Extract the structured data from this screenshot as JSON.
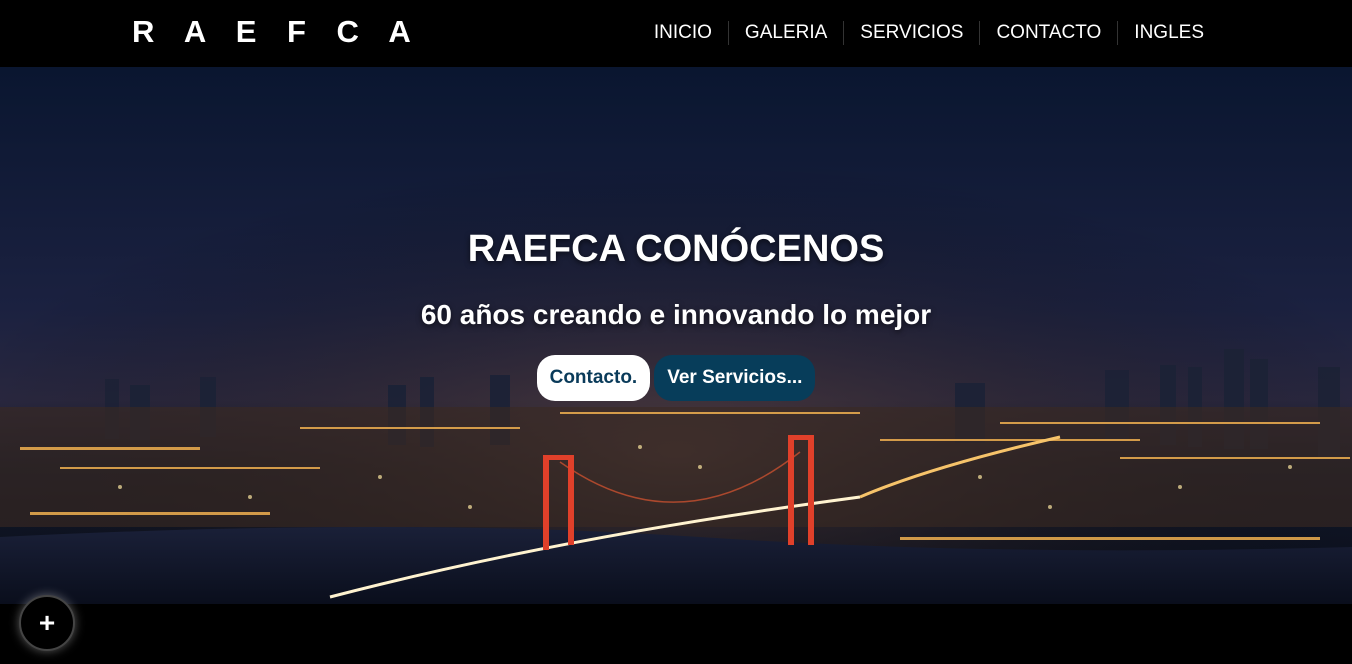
{
  "header": {
    "brand": "R A E F C A",
    "nav": [
      "INICIO",
      "GALERIA",
      "SERVICIOS",
      "CONTACTO",
      "INGLES"
    ]
  },
  "hero": {
    "title": "RAEFCA CONÓCENOS",
    "subtitle": "60 años creando e innovando lo mejor",
    "primary_button": "Contacto.",
    "secondary_button": "Ver Servicios..."
  },
  "fab": {
    "icon": "plus-icon",
    "symbol": "+"
  },
  "colors": {
    "header_bg": "#000000",
    "button_primary_bg": "#ffffff",
    "button_primary_text": "#0a3b5a",
    "button_secondary_bg": "#073d5a",
    "bridge_accent": "#e0402a"
  }
}
